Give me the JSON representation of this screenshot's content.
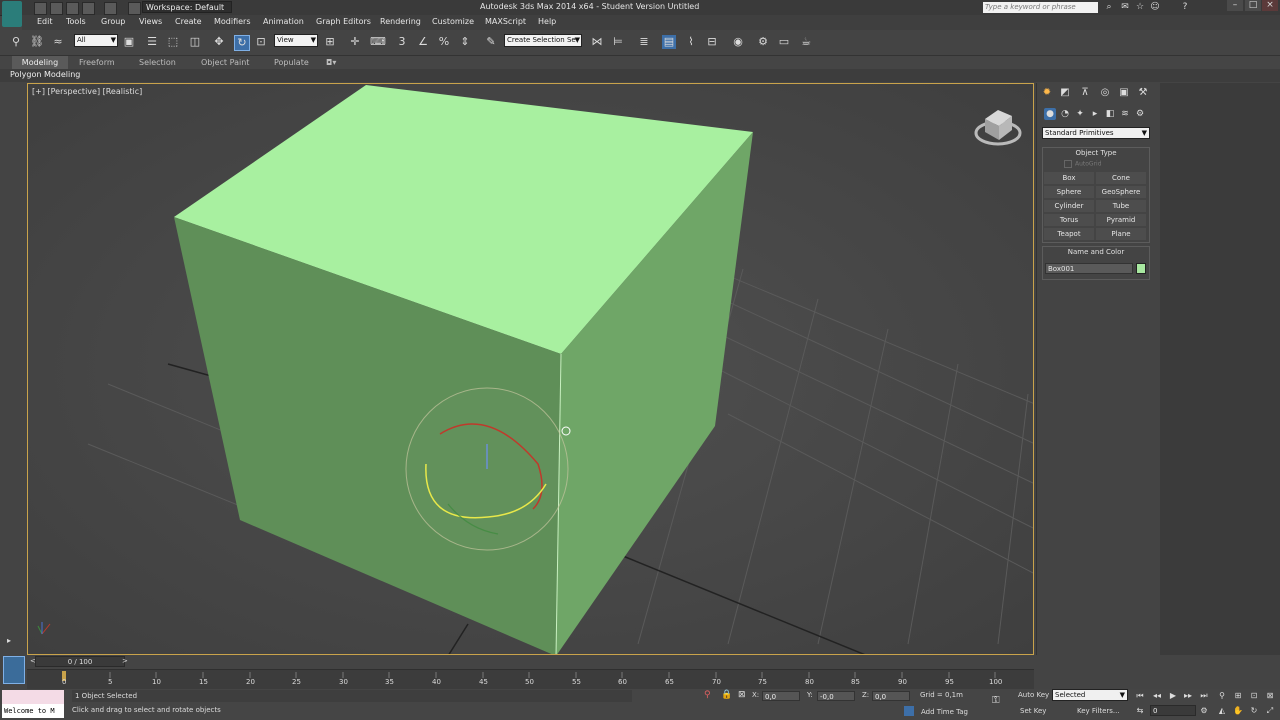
{
  "titlebar": {
    "workspace": "Workspace: Default",
    "app_title": "Autodesk 3ds Max 2014 x64  -  Student Version   Untitled",
    "help_search_placeholder": "Type a keyword or phrase"
  },
  "menu": [
    "Edit",
    "Tools",
    "Group",
    "Views",
    "Create",
    "Modifiers",
    "Animation",
    "Graph Editors",
    "Rendering",
    "Customize",
    "MAXScript",
    "Help"
  ],
  "toolbar": {
    "selection_filter": "All",
    "ref_coord": "View",
    "named_selection": "Create Selection Se"
  },
  "ribbon": {
    "tabs": [
      "Modeling",
      "Freeform",
      "Selection",
      "Object Paint",
      "Populate"
    ],
    "panel_label": "Polygon Modeling"
  },
  "viewport": {
    "label": "[+] [Perspective] [Realistic]",
    "object_color": "#a8e8a0"
  },
  "command_panel": {
    "category": "Standard Primitives",
    "object_type_title": "Object Type",
    "autogrid": "AutoGrid",
    "buttons": [
      "Box",
      "Cone",
      "Sphere",
      "GeoSphere",
      "Cylinder",
      "Tube",
      "Torus",
      "Pyramid",
      "Teapot",
      "Plane"
    ],
    "name_color_title": "Name and Color",
    "name_value": "Box001",
    "swatch_color": "#a8e8a0"
  },
  "timeline": {
    "frame_display": "0 / 100",
    "ticks": [
      "0",
      "5",
      "10",
      "15",
      "20",
      "25",
      "30",
      "35",
      "40",
      "45",
      "50",
      "55",
      "60",
      "65",
      "70",
      "75",
      "80",
      "85",
      "90",
      "95",
      "100"
    ]
  },
  "status": {
    "maxscript": "Welcome to M",
    "selection": "1 Object Selected",
    "prompt": "Click and drag to select and rotate objects",
    "x_label": "X:",
    "x": "0,0",
    "y_label": "Y:",
    "y": "-0,0",
    "z_label": "Z:",
    "z": "0,0",
    "grid": "Grid = 0,1m",
    "auto_key": "Auto Key",
    "set_key": "Set Key",
    "key_mode": "Selected",
    "key_filters": "Key Filters...",
    "current_frame": "0",
    "add_time_tag": "Add Time Tag"
  }
}
